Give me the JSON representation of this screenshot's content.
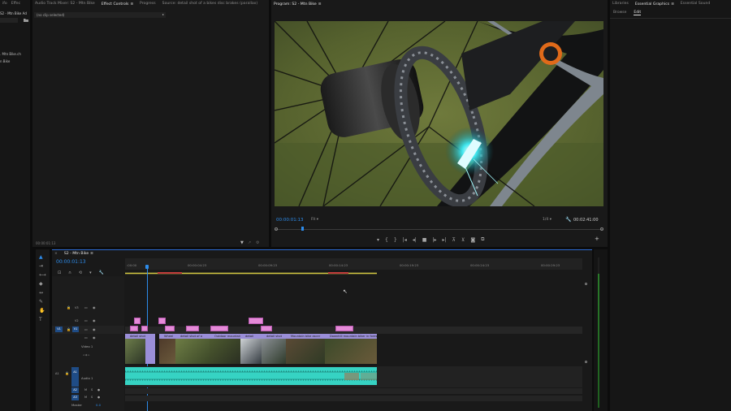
{
  "project_panel": {
    "tabs": [
      "ifo",
      "Effec"
    ],
    "item1": "S2 - Mtn Bike Ad",
    "item2": ". Mtn Bike.ch",
    "item3": "n Bike"
  },
  "source_panel": {
    "tabs": [
      {
        "label": "Audio Track Mixer: S2 - Mtn Bike",
        "active": false,
        "menu": false
      },
      {
        "label": "Effect Controls",
        "active": true,
        "menu": true
      },
      {
        "label": "Progress",
        "active": false,
        "menu": false
      },
      {
        "label": "Source: detail shot of a bikes disc brakes (parallax)",
        "active": false,
        "menu": false
      }
    ],
    "no_clip": "(no clip selected)",
    "timecode": "00:00:01:13"
  },
  "program_monitor": {
    "title": "Program: S2 - Mtn Bike",
    "timecode": "00:00:01:13",
    "fit": "Fit",
    "resolution": "1/4",
    "duration": "00:02:41:00",
    "controls": [
      "marker-icon",
      "in-point-icon",
      "out-point-icon",
      "go-to-in-icon",
      "step-back-icon",
      "stop-icon",
      "step-forward-icon",
      "go-to-out-icon",
      "lift-icon",
      "extract-icon",
      "export-frame-icon",
      "comparison-icon"
    ]
  },
  "essential_graphics": {
    "tabs": [
      {
        "label": "Libraries",
        "active": false
      },
      {
        "label": "Essential Graphics",
        "active": true
      },
      {
        "label": "Essential Sound",
        "active": false
      }
    ],
    "subtabs": [
      "Browse",
      "Edit"
    ]
  },
  "timeline": {
    "title": "S2 - Mtn Bike",
    "timecode": "00:00:01:13",
    "ruler": [
      ":00:00",
      "00:00:04:23",
      "00:00:09:23",
      "00:00:14:23",
      "00:00:19:23",
      "00:00:24:23",
      "00:00:29:23"
    ],
    "tracks": {
      "v3": "V3",
      "v2": "V2",
      "v1": "V1",
      "video1": "Video 1",
      "a1": "A1",
      "audio1": "Audio 1",
      "a2": "A2",
      "a3": "A3",
      "master": "Master",
      "master_val": "0.0"
    },
    "clips": [
      "detail shot",
      "Wheel",
      "detail shot of a",
      "Outdoor mountain",
      "detail",
      "detail shot",
      "Mountain bike ascer",
      "Downhill mountain biker in forest"
    ]
  },
  "colors": {
    "accent": "#2d8ceb",
    "audio_clip": "#36d3c3",
    "video_clip": "#9a8ed8",
    "adjust_clip": "#e58ad8"
  }
}
